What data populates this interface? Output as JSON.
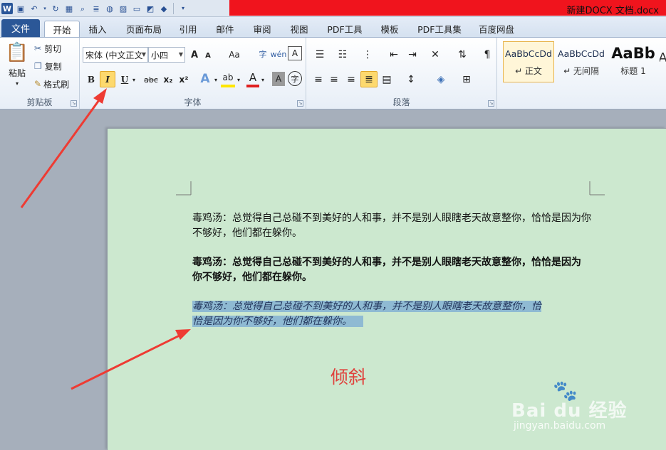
{
  "window": {
    "doc_title": "新建DOCX 文档.docx"
  },
  "tabs": {
    "file": "文件",
    "items": [
      "开始",
      "插入",
      "页面布局",
      "引用",
      "邮件",
      "审阅",
      "视图",
      "PDF工具",
      "模板",
      "PDF工具集",
      "百度网盘"
    ],
    "active": "开始"
  },
  "clipboard": {
    "paste": "粘贴",
    "cut": "剪切",
    "copy": "复制",
    "format_painter": "格式刷",
    "label": "剪贴板"
  },
  "font": {
    "family": "宋体 (中文正文",
    "size": "小四",
    "bold": "B",
    "italic": "I",
    "underline": "U",
    "strike": "abc",
    "subscript": "x₂",
    "superscript": "x²",
    "aa": "Aa",
    "grow": "A",
    "shrink": "A",
    "label": "字体"
  },
  "paragraph": {
    "label": "段落"
  },
  "styles": [
    {
      "sample": "AaBbCcDd",
      "name": "↵ 正文"
    },
    {
      "sample": "AaBbCcDd",
      "name": "↵ 无间隔"
    },
    {
      "sample": "AaBb",
      "name": "标题 1"
    }
  ],
  "document": {
    "para_normal": [
      "毒鸡汤：总觉得自己总碰不到美好的人和事，并不是别人眼瞎老天故意整你，恰恰是因为你",
      "不够好，他们都在躲你。"
    ],
    "para_bold": [
      "毒鸡汤：总觉得自己总碰不到美好的人和事，并不是别人眼瞎老天故意整你，恰恰是因为",
      "你不够好，他们都在躲你。"
    ],
    "para_italic": [
      "毒鸡汤：总觉得自己总碰不到美好的人和事，并不是别人眼瞎老天故意整你，恰",
      "恰是因为你不够好，他们都在躲你。"
    ],
    "annotation": "倾斜"
  },
  "watermark": {
    "brand": "Bai du 经验",
    "url": "jingyan.baidu.com"
  },
  "colors": {
    "file_tab": "#2b5797",
    "title_red": "#f0141d",
    "page_bg": "#cce8cf",
    "selection": "#8fbad3",
    "annotation": "#e0403b",
    "highlight": "#fdd96e"
  }
}
